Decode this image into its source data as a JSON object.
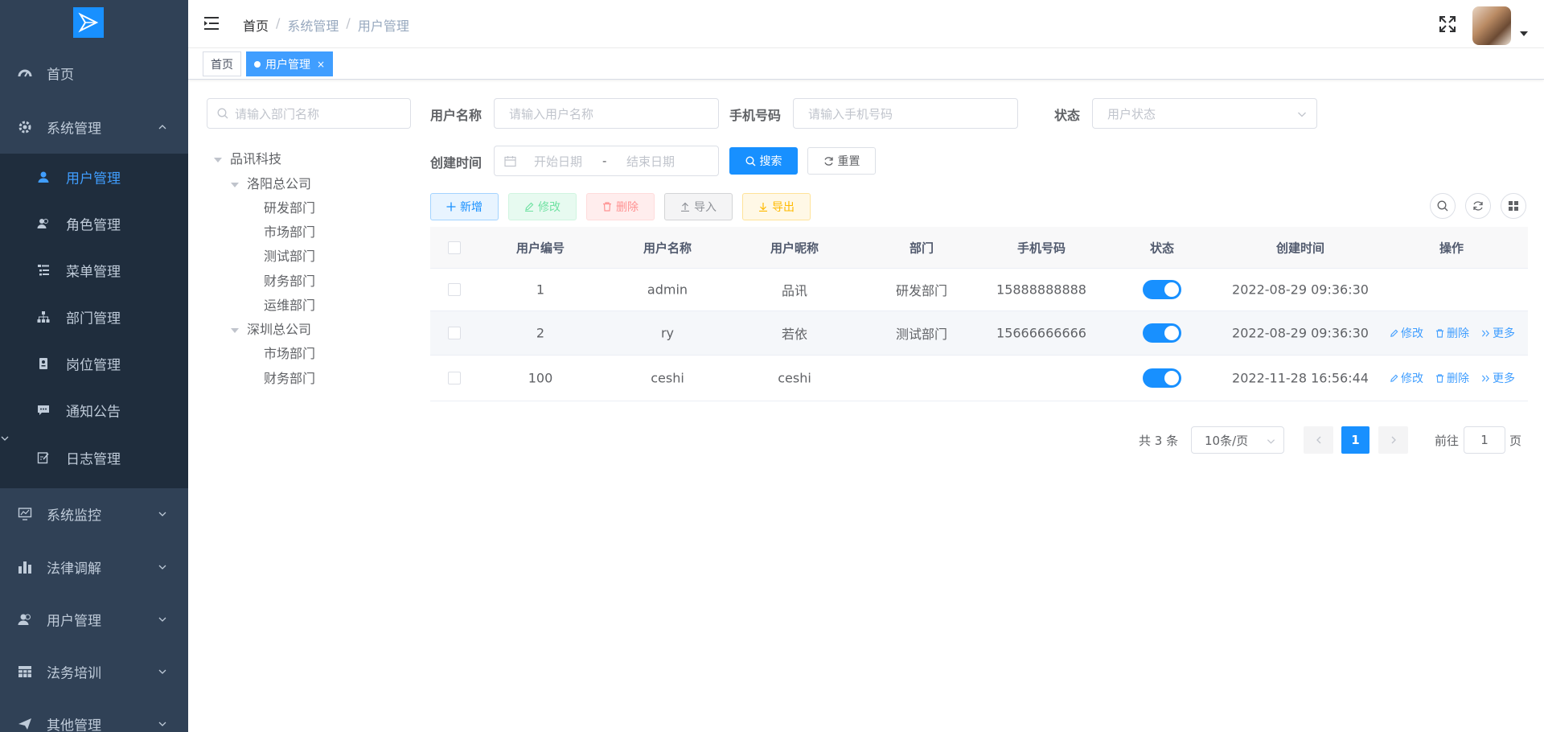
{
  "sidebar": {
    "items": [
      {
        "label": "首页",
        "icon": "dashboard-icon"
      },
      {
        "label": "系统管理",
        "icon": "gear-icon",
        "expanded": true
      },
      {
        "label": "系统监控",
        "icon": "monitor-icon"
      },
      {
        "label": "法律调解",
        "icon": "bar-chart-icon"
      },
      {
        "label": "用户管理",
        "icon": "peoples-icon"
      },
      {
        "label": "法务培训",
        "icon": "table-icon"
      },
      {
        "label": "其他管理",
        "icon": "send-icon"
      }
    ],
    "submenu": [
      {
        "label": "用户管理",
        "icon": "user-icon",
        "active": true
      },
      {
        "label": "角色管理",
        "icon": "peoples-icon"
      },
      {
        "label": "菜单管理",
        "icon": "tree-table-icon"
      },
      {
        "label": "部门管理",
        "icon": "tree-icon"
      },
      {
        "label": "岗位管理",
        "icon": "post-icon"
      },
      {
        "label": "通知公告",
        "icon": "message-icon"
      },
      {
        "label": "日志管理",
        "icon": "log-icon"
      }
    ]
  },
  "header": {
    "breadcrumb": [
      "首页",
      "系统管理",
      "用户管理"
    ]
  },
  "tags": {
    "home": "首页",
    "active": "用户管理",
    "close": "×"
  },
  "tree": {
    "search_placeholder": "请输入部门名称",
    "root": "品讯科技",
    "groups": [
      {
        "label": "洛阳总公司",
        "children": [
          "研发部门",
          "市场部门",
          "测试部门",
          "财务部门",
          "运维部门"
        ]
      },
      {
        "label": "深圳总公司",
        "children": [
          "市场部门",
          "财务部门"
        ]
      }
    ]
  },
  "form": {
    "username_label": "用户名称",
    "username_placeholder": "请输入用户名称",
    "phone_label": "手机号码",
    "phone_placeholder": "请输入手机号码",
    "status_label": "状态",
    "status_placeholder": "用户状态",
    "created_label": "创建时间",
    "start_placeholder": "开始日期",
    "range_sep": "-",
    "end_placeholder": "结束日期",
    "search_button": "搜索",
    "reset_button": "重置"
  },
  "toolbar": {
    "add": "新增",
    "edit": "修改",
    "delete": "删除",
    "import": "导入",
    "export": "导出"
  },
  "table": {
    "columns": [
      "用户编号",
      "用户名称",
      "用户昵称",
      "部门",
      "手机号码",
      "状态",
      "创建时间",
      "操作"
    ],
    "rows": [
      {
        "id": "1",
        "username": "admin",
        "nickname": "品讯",
        "dept": "研发部门",
        "phone": "15888888888",
        "status": true,
        "created": "2022-08-29 09:36:30",
        "actions": false
      },
      {
        "id": "2",
        "username": "ry",
        "nickname": "若依",
        "dept": "测试部门",
        "phone": "15666666666",
        "status": true,
        "created": "2022-08-29 09:36:30",
        "actions": true
      },
      {
        "id": "100",
        "username": "ceshi",
        "nickname": "ceshi",
        "dept": "",
        "phone": "",
        "status": true,
        "created": "2022-11-28 16:56:44",
        "actions": true
      }
    ],
    "action_labels": {
      "edit": "修改",
      "delete": "删除",
      "more": "更多"
    }
  },
  "pagination": {
    "total": "共 3 条",
    "page_size": "10条/页",
    "current": "1",
    "goto_label": "前往",
    "goto_value": "1",
    "page_unit": "页"
  },
  "colors": {
    "sidebar_bg": "#304156",
    "submenu_bg": "#1f2d3d",
    "primary": "#1890ff",
    "active_text": "#409eff"
  }
}
